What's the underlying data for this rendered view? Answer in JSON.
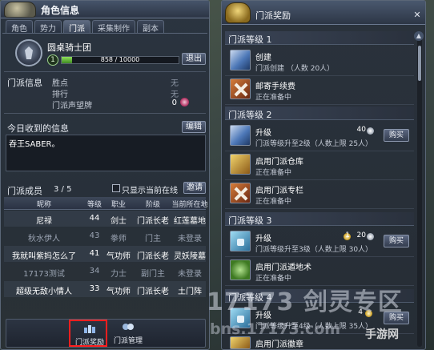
{
  "left_panel": {
    "title": "角色信息",
    "tabs": [
      "角色",
      "势力",
      "门派",
      "采集制作",
      "副本"
    ],
    "active_tab": "门派",
    "guild": {
      "name": "圆桌骑士团",
      "level": "1",
      "xp_text": "858 / 10000",
      "xp_progress": 0.0858,
      "leave_button": "退出"
    },
    "info": {
      "section_label": "门派信息",
      "rows": [
        {
          "key": "胜点",
          "value": "无"
        },
        {
          "key": "排行",
          "value": "无"
        },
        {
          "key": "门派声望牌",
          "value": "0"
        }
      ]
    },
    "message": {
      "label": "今日收到的信息",
      "edit_button": "编辑",
      "text": "吞王SABER。"
    },
    "members": {
      "label": "门派成员",
      "count": "3 / 5",
      "online_only_label": "只显示当前在线",
      "invite_button": "邀请",
      "columns": [
        "昵称",
        "等级",
        "职业",
        "阶级",
        "当前所在地"
      ],
      "rows": [
        {
          "name": "尼禄",
          "level": "44",
          "class": "剑士",
          "rank": "门派长老",
          "location": "红莲墓地",
          "online": true
        },
        {
          "name": "秋水伊人",
          "level": "43",
          "class": "拳师",
          "rank": "门主",
          "location": "未登录",
          "online": false
        },
        {
          "name": "我就叫紫妈怎么了",
          "level": "41",
          "class": "气功师",
          "rank": "门派长老",
          "location": "灵妖陵墓",
          "online": true
        },
        {
          "name": "17173测试",
          "level": "34",
          "class": "力士",
          "rank": "副门主",
          "location": "未登录",
          "online": false
        },
        {
          "name": "超级无敌小情人",
          "level": "33",
          "class": "气功师",
          "rank": "门派长老",
          "location": "土门阵",
          "online": true
        }
      ]
    },
    "bottom_buttons": [
      {
        "label": "门派奖励",
        "icon": "guild-reward-icon",
        "highlighted": true
      },
      {
        "label": "门派管理",
        "icon": "guild-manage-icon",
        "highlighted": false
      }
    ]
  },
  "right_panel": {
    "title": "门派奖励",
    "close_icon": "✕",
    "levels": [
      {
        "header": "门派等级 1",
        "items": [
          {
            "icon": "scroll-icon",
            "name": "创建",
            "desc": "门派创建 （人数 20人）"
          },
          {
            "icon": "locked-x-icon",
            "name": "邮寄手续费",
            "desc": "正在准备中"
          }
        ]
      },
      {
        "header": "门派等级 2",
        "items": [
          {
            "icon": "scroll-icon",
            "name": "升级",
            "desc": "门派等级升至2级（人数上限 25人）",
            "price": "40",
            "coin": "silver",
            "buy": "购买"
          },
          {
            "icon": "chest-icon",
            "name": "启用门派仓库",
            "desc": "正在准备中"
          },
          {
            "icon": "locked-x-icon",
            "name": "启用门派专栏",
            "desc": "正在准备中"
          }
        ]
      },
      {
        "header": "门派等级 3",
        "items": [
          {
            "icon": "lock-icon",
            "name": "升级",
            "desc": "门派等级升至3级（人数上限 30人）",
            "price_gold": "1",
            "price": "20",
            "coin": "gold+silver",
            "buy": "购买"
          },
          {
            "icon": "seal-icon",
            "name": "启用门派遁地术",
            "desc": "正在准备中"
          }
        ]
      },
      {
        "header": "门派等级 4",
        "items": [
          {
            "icon": "lock-icon",
            "name": "升级",
            "desc": "门派等级升至4级（人数上限 35人）",
            "price": "4",
            "coin": "gold",
            "buy": "购买"
          },
          {
            "icon": "chest-icon",
            "name": "启用门派徽章",
            "desc": ""
          }
        ]
      }
    ]
  },
  "watermark": {
    "main": "17173 剑灵专区",
    "sub": "bns.17173.com",
    "corner": "手游网"
  },
  "colors": {
    "xp_green": "#8fe05a",
    "highlight_red": "#ff1e1e",
    "panel_bg": "#2a323c"
  }
}
